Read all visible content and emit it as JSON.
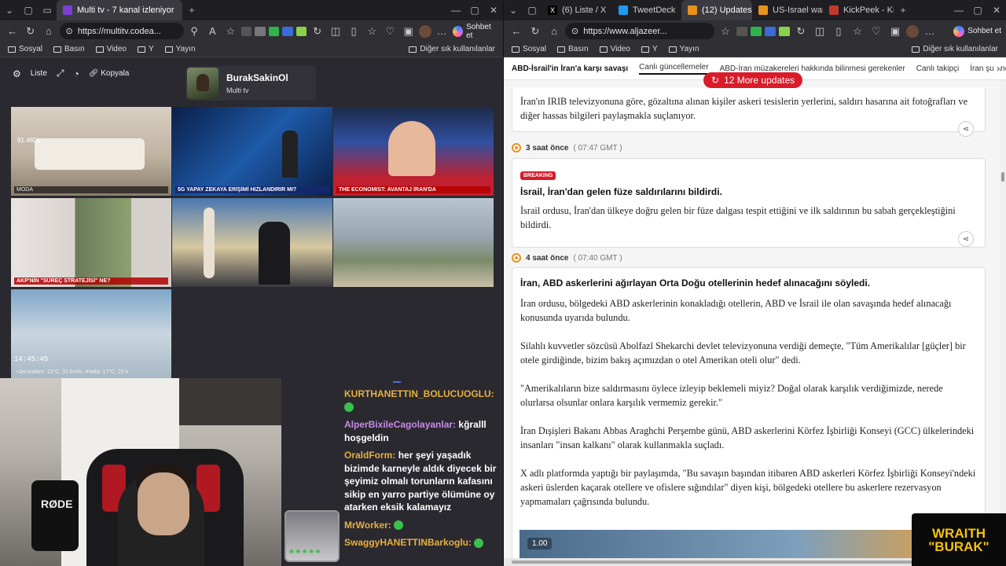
{
  "left_window": {
    "tabs": [
      {
        "label": "Multi tv - 7 kanal izleniyor",
        "active": true
      }
    ],
    "url": "https://multitv.codea...",
    "favorites": [
      "Sosyal",
      "Basın",
      "Video",
      "Y",
      "Yayın"
    ],
    "favorites_right": "Diğer sık kullanılanlar",
    "copilot_label": "Sohbet et"
  },
  "multitv": {
    "toolbar": {
      "list_label": "Liste",
      "copy_label": "Kopyala"
    },
    "profile": {
      "name": "BurakSakinOl",
      "subtitle": "Multi tv"
    },
    "tiles": [
      {
        "caption": "MODA",
        "style": "dark",
        "extra": "91.480₺"
      },
      {
        "caption": "5G YAPAY ZEKAYA ERİŞİMİ HIZLANDIRIR MI?",
        "style": "blue"
      },
      {
        "caption": "THE ECONOMIST: AVANTAJ İRAN'DA",
        "style": "red"
      },
      {
        "caption": "AKP'NİN \"SÜREÇ STRATEJİSİ\" NE?",
        "style": "red"
      },
      {
        "caption": "",
        "style": "none"
      },
      {
        "caption": "",
        "style": "none"
      },
      {
        "caption": "•Jerusalem: 13°C, 31 km/h, •Haifa: 17°C, 25 k",
        "style": "dark",
        "clock": "14:45:45"
      }
    ]
  },
  "chat": {
    "messages": [
      {
        "user": "KURTHANETTIN_BOLUCUOGLU:",
        "text": "",
        "emote": true,
        "color": "g"
      },
      {
        "user": "AlperBixileCagolayanlar:",
        "text": "kğralll hoşgeldin",
        "emote": false,
        "color": "p"
      },
      {
        "user": "OraldForm:",
        "text": "her şeyi yaşadık bizimde karneyle aldık diyecek bir şeyimiz olmalı torunların kafasını sikip en yarro partiye ölümüne oy atarken eksik kalamayız",
        "emote": false,
        "color": "g"
      },
      {
        "user": "MrWorker:",
        "text": "",
        "emote": true,
        "color": "g"
      },
      {
        "user": "SwaggyHANETTINBarkoglu:",
        "text": "",
        "emote": true,
        "color": "g"
      }
    ],
    "webcam_mic_label": "RØDE"
  },
  "right_window": {
    "tabs": [
      {
        "label": "(6) Liste / X",
        "active": false
      },
      {
        "label": "TweetDeck",
        "active": false
      },
      {
        "label": "(12) Updates",
        "active": true
      },
      {
        "label": "US-Israel war",
        "active": false
      },
      {
        "label": "KickPeek - Kic",
        "active": false
      }
    ],
    "url": "https://www.aljazeer...",
    "favorites": [
      "Sosyal",
      "Basın",
      "Video",
      "Y",
      "Yayın"
    ],
    "favorites_right": "Diğer sık kullanılanlar",
    "copilot_label": "Sohbet et"
  },
  "aljazeera": {
    "nav": [
      {
        "label": "ABD-İsrail'in İran'a karşı savaşı",
        "style": "bold"
      },
      {
        "label": "Canlı güncellemeler",
        "style": "active"
      },
      {
        "label": "ABD-İran müzakereleri hakkında bilinmesi gerekenler",
        "style": ""
      },
      {
        "label": "Canlı takipçi",
        "style": ""
      },
      {
        "label": "İran şu anda dah",
        "style": ""
      }
    ],
    "more_updates": "12 More updates",
    "card1_text": "İran'ın IRIB televizyonuna göre, gözaltına alınan kişiler askeri tesislerin yerlerini, saldırı hasarına ait fotoğrafları ve diğer hassas bilgileri paylaşmakla suçlanıyor.",
    "entry2": {
      "ago": "3 saat önce",
      "time": "( 07:47 GMT )",
      "badge": "BREAKING",
      "title": "İsrail, İran'dan gelen füze saldırılarını bildirdi.",
      "body": "İsrail ordusu, İran'dan ülkeye doğru gelen bir füze dalgası tespit ettiğini ve ilk saldırının bu sabah gerçekleştiğini bildirdi."
    },
    "entry3": {
      "ago": "4 saat önce",
      "time": "( 07:40 GMT )",
      "title": "İran, ABD askerlerini ağırlayan Orta Doğu otellerinin hedef alınacağını söyledi.",
      "p1": "İran ordusu, bölgedeki ABD askerlerinin konakladığı otellerin, ABD ve İsrail ile olan savaşında hedef alınacağı konusunda uyarıda bulundu.",
      "p2": "Silahlı kuvvetler sözcüsü Abolfazl Shekarchi devlet televizyonuna verdiği demeçte, \"Tüm Amerikalılar [güçler] bir otele girdiğinde, bizim bakış açımızdan o otel Amerikan oteli olur\" dedi.",
      "p3": "\"Amerikalıların bize saldırmasını öylece izleyip beklemeli miyiz? Doğal olarak karşılık verdiğimizde, nerede olurlarsa olsunlar onlara karşılık vermemiz gerekir.\"",
      "p4": "İran Dışişleri Bakanı Abbas Araghchi Perşembe günü, ABD askerlerini Körfez İşbirliği Konseyi (GCC) ülkelerindeki insanları \"insan kalkanı\" olarak kullanmakla suçladı.",
      "p5": "X adlı platformda yaptığı bir paylaşımda, \"Bu savaşın başından itibaren ABD askerleri Körfez İşbirliği Konseyi'ndeki askeri üslerden kaçarak otellere ve ofislere sığındılar\" diyen kişi, bölgedeki otellere bu askerlere rezervasyon yapmamaları çağrısında bulundu."
    },
    "video_time": "1.00"
  },
  "overlay": {
    "line1": "WRAITH",
    "line2": "\"BURAK\""
  }
}
